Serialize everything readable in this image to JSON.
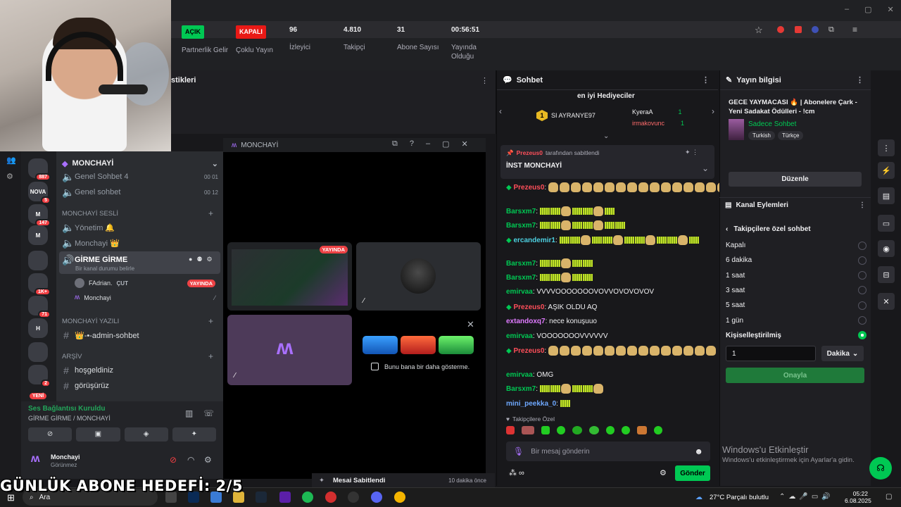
{
  "browser": {
    "window_controls": [
      "–",
      "▢",
      "✕"
    ]
  },
  "dashboard": {
    "section_title": "stikleri",
    "stats": [
      {
        "badge": "AÇIK",
        "badge_color": "#00c853",
        "label": "Partnerlik Gelir"
      },
      {
        "badge": "KAPALI",
        "badge_color": "#e91916",
        "label": "Çoklu Yayın"
      },
      {
        "num": "96",
        "label": "İzleyici"
      },
      {
        "num": "4.810",
        "label": "Takipçi"
      },
      {
        "num": "31",
        "label": "Abone Sayısı"
      },
      {
        "num": "00:56:51",
        "label": "Yayında Olduğu"
      }
    ],
    "pinned_label": "Mesai Sabitlendi",
    "pinned_time": "10 dakika önce"
  },
  "discord": {
    "window_title": "MONCHAYİ",
    "server_name": "MONCHAYİ",
    "servers": [
      {
        "label": "",
        "badge": "887"
      },
      {
        "label": "NOVA",
        "badge": "5"
      },
      {
        "label": "M",
        "badge": "147"
      },
      {
        "label": "M",
        "badge": ""
      },
      {
        "label": "",
        "badge": ""
      },
      {
        "label": "",
        "badge": "1K+"
      },
      {
        "label": "",
        "badge": "71"
      },
      {
        "label": "H",
        "badge": ""
      },
      {
        "label": "",
        "badge": ""
      },
      {
        "label": "",
        "badge": "2"
      },
      {
        "label": "",
        "badge": "YENİ"
      }
    ],
    "voice_top": [
      {
        "name": "Genel Sohbet 4",
        "count_a": "00",
        "count_b": "01"
      },
      {
        "name": "Genel sohbet",
        "count_a": "00",
        "count_b": "12"
      }
    ],
    "cat_voice": "MONCHAYİ SESLİ",
    "voice_channels": [
      "Yönetim 🔔",
      "Monchayi 👑"
    ],
    "active_channel": "GİRME GİRME",
    "active_channel_status": "Bir kanal durumu belirle",
    "members": [
      {
        "name": "FAdrian.",
        "tag": "ÇUT",
        "live": "YAYINDA"
      },
      {
        "name": "Monchayi",
        "tag": "",
        "live": ""
      }
    ],
    "cat_text": "MONCHAYİ YAZILI",
    "admin_channel": "👑-•-admin-sohbet",
    "cat_archive": "ARŞİV",
    "archive_channels": [
      "hoşgeldiniz",
      "görüşürüz"
    ],
    "voice_status": "Ses Bağlantısı Kuruldu",
    "voice_location": "GİRME GİRME / MONCHAYİ",
    "user_name": "Monchayi",
    "user_status": "Görünmez",
    "live_tile_badge": "YAYINDA",
    "promo_checkbox": "Bunu bana bir daha gösterme."
  },
  "chat": {
    "title": "Sohbet",
    "gifters_title": "en iyi Hediyeciler",
    "gifters": [
      {
        "rank": "1",
        "name": "SI AYRANYE97"
      },
      {
        "name": "KyeraA",
        "count": "1"
      },
      {
        "name": "irmakovunc",
        "count": "1"
      }
    ],
    "pinned_by": "tarafından sabitlendi",
    "pinned_text": "İNST MONCHAYİ",
    "messages": [
      {
        "user": "Prezeus0",
        "text": "",
        "color": "red",
        "emotes": 16
      },
      {
        "user": "Barsxm7",
        "text": "",
        "color": "green",
        "emotes": 7
      },
      {
        "user": "Barsxm7",
        "text": "",
        "color": "green",
        "emotes": 8
      },
      {
        "user": "ercandemir1",
        "text": "",
        "color": "teal",
        "emotes": 13
      },
      {
        "user": "Barsxm7",
        "text": "",
        "color": "green",
        "emotes": 5
      },
      {
        "user": "Barsxm7",
        "text": "",
        "color": "green",
        "emotes": 5
      },
      {
        "user": "emirvaa",
        "text": "VVVVOOOOOOOVOVVOVOVOVOV",
        "color": "green",
        "emotes": 0
      },
      {
        "user": "Prezeus0",
        "text": "AŞIK OLDU AQ",
        "color": "red",
        "emotes": 0
      },
      {
        "user": "extandoxq7",
        "text": "nece konuşuuo",
        "color": "pink",
        "emotes": 0
      },
      {
        "user": "emirvaa",
        "text": "VOOOOOOOVVVVVV",
        "color": "green",
        "emotes": 0
      },
      {
        "user": "Prezeus0",
        "text": "",
        "color": "red",
        "emotes": 15
      },
      {
        "user": "emirvaa",
        "text": "OMG",
        "color": "green",
        "emotes": 0
      },
      {
        "user": "Barsxm7",
        "text": "",
        "color": "green",
        "emotes": 6
      },
      {
        "user": "mini_peekka_0",
        "text": "",
        "color": "blue",
        "emotes": 1
      }
    ],
    "followers_only_label": "Takipçilere Özel",
    "input_placeholder": "Bir mesaj gönderin",
    "send_label": "Gönder"
  },
  "info": {
    "title": "Yayın bilgisi",
    "stream_title": "GECE YAYMACASI 🔥 | Abonelere Çark - Yeni Sadakat Ödülleri - !cm",
    "category": "Sadece Sohbet",
    "tags": [
      "Turkish",
      "Türkçe"
    ],
    "edit_label": "Düzenle",
    "actions_title": "Kanal Eylemleri",
    "followers_chat_title": "Takipçilere özel sohbet",
    "options": [
      {
        "label": "Kapalı",
        "selected": false
      },
      {
        "label": "6 dakika",
        "selected": false
      },
      {
        "label": "1 saat",
        "selected": false
      },
      {
        "label": "3 saat",
        "selected": false
      },
      {
        "label": "5 saat",
        "selected": false
      },
      {
        "label": "1 gün",
        "selected": false
      },
      {
        "label": "Kişiselleştirilmiş",
        "selected": true
      }
    ],
    "custom_value": "1",
    "unit_label": "Dakika",
    "confirm_label": "Onayla"
  },
  "activation": {
    "title": "Windows'u Etkinleştir",
    "subtitle": "Windows'u etkinleştirmek için Ayarlar'a gidin."
  },
  "overlay": {
    "goal_text": "GÜNLÜK ABONE HEDEFİ: 2/5"
  },
  "taskbar": {
    "search_label": "Ara",
    "weather": "27°C  Parçalı bulutlu",
    "time": "05:22",
    "date": "6.08.2025"
  },
  "colors": {
    "accent_green": "#00c853",
    "live_red": "#e91916",
    "discord_bg": "#313338"
  }
}
